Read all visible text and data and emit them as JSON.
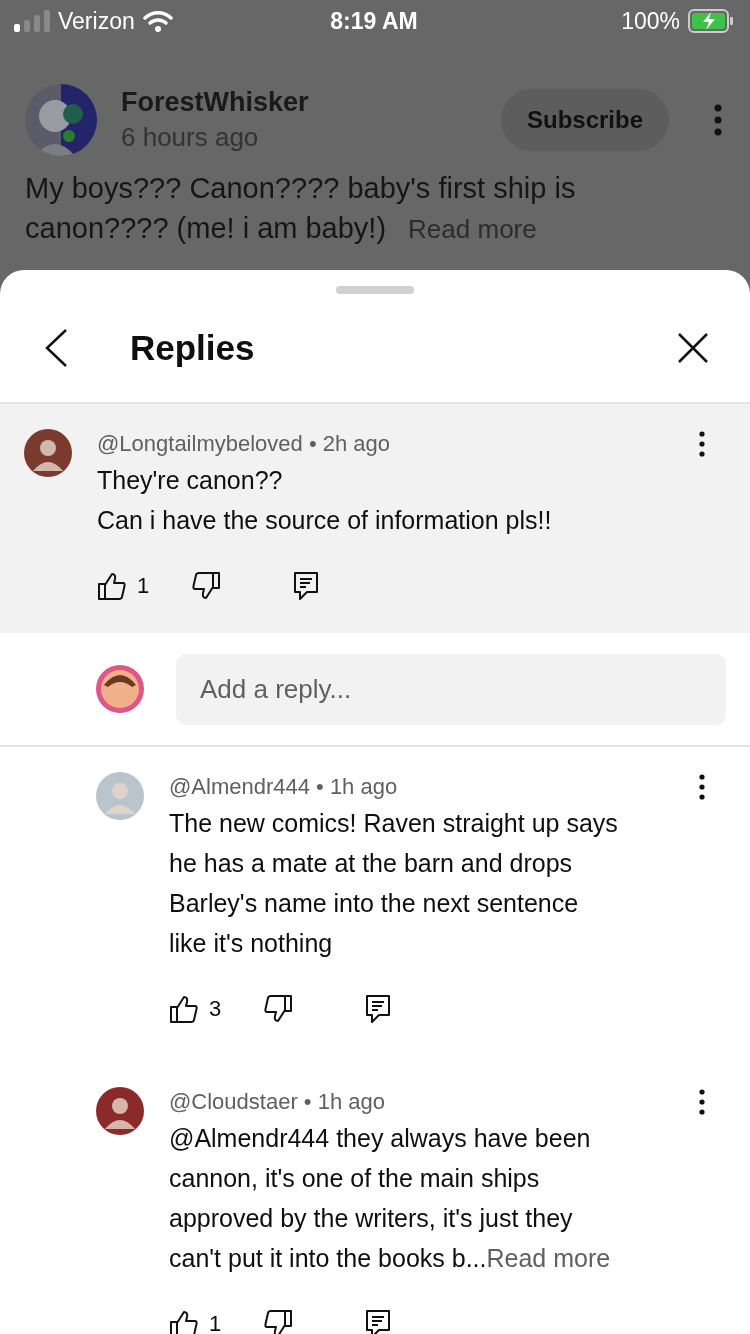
{
  "status_bar": {
    "carrier": "Verizon",
    "time": "8:19 AM",
    "battery": "100%"
  },
  "background_comment": {
    "author": "ForestWhisker",
    "time": "6 hours ago",
    "subscribe": "Subscribe",
    "text": "My boys??? Canon???? baby's first ship is\ncanon???? (me! i am baby!)",
    "read_more": "Read more"
  },
  "sheet": {
    "title": "Replies",
    "comments": [
      {
        "kind": "parent",
        "handle": "@Longtailmybeloved",
        "separator": "•",
        "time": "2h ago",
        "text": "They're canon??\nCan i have the source of information pls!!",
        "likes": "1"
      },
      {
        "kind": "reply",
        "handle": "@Almendr444",
        "separator": "•",
        "time": "1h ago",
        "text": "The new comics! Raven straight up says\nhe has a mate at the barn and drops\nBarley's name into the next sentence\nlike it's nothing",
        "likes": "3"
      },
      {
        "kind": "reply",
        "handle": "@Cloudstaer",
        "separator": "•",
        "time": "1h ago",
        "text": "@Almendr444  they always have been\ncannon, it's one of the main ships\napproved by the writers, it's just they\ncan't put it into the books b...",
        "read_more": "Read more",
        "likes": "1"
      }
    ],
    "reply_field": {
      "placeholder": "Add a reply..."
    }
  }
}
